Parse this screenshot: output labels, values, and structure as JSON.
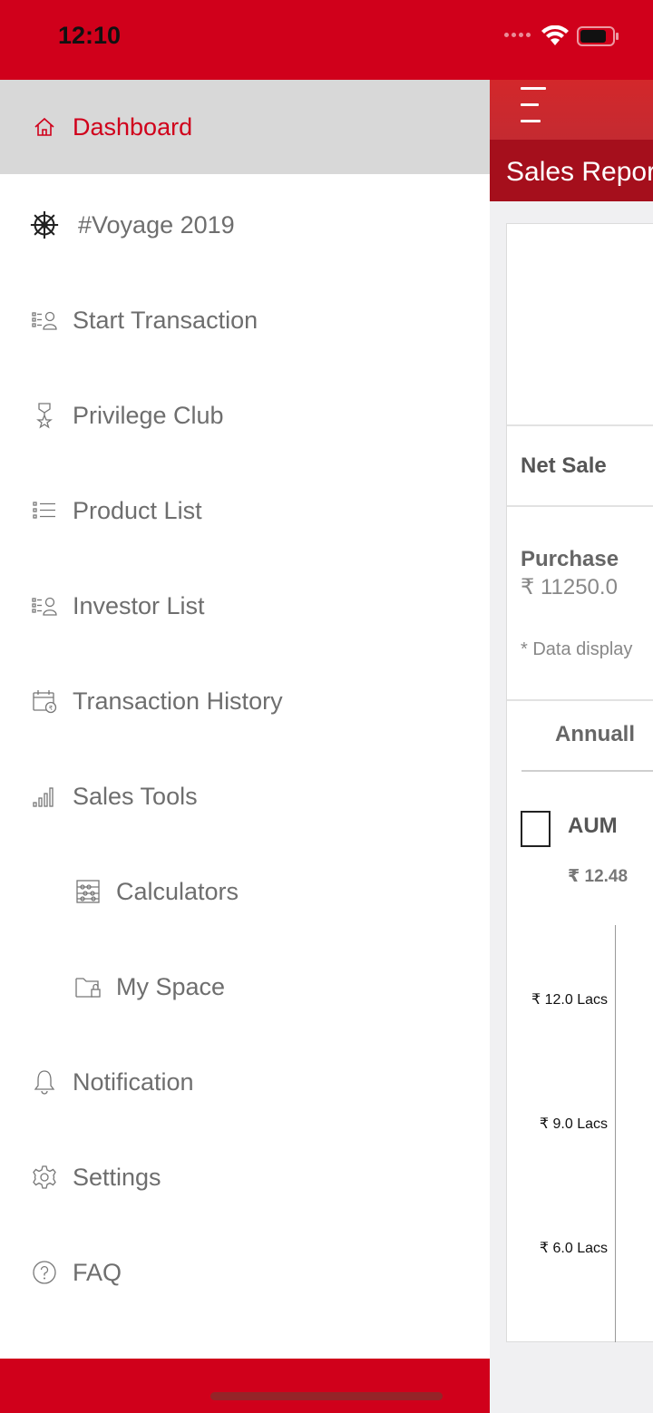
{
  "status_bar": {
    "time": "12:10"
  },
  "background_app": {
    "title": "Sales Repor",
    "net_sale_label": "Net Sale",
    "purchase_label": "Purchase",
    "purchase_value": "₹ 11250.0",
    "note": "* Data display",
    "tab_label": "Annuall",
    "legend_label": "AUM",
    "aum_value": "₹ 12.48",
    "y_ticks": [
      "₹ 12.0 Lacs",
      "₹ 9.0 Lacs",
      "₹ 6.0 Lacs"
    ]
  },
  "drawer": {
    "items": [
      {
        "label": "Dashboard",
        "icon": "home-icon",
        "active": true
      },
      {
        "label": "#Voyage 2019",
        "icon": "ship-wheel-icon"
      },
      {
        "label": "Start Transaction",
        "icon": "transaction-user-icon"
      },
      {
        "label": "Privilege Club",
        "icon": "award-icon"
      },
      {
        "label": "Product List",
        "icon": "list-icon"
      },
      {
        "label": "Investor List",
        "icon": "investor-list-icon"
      },
      {
        "label": "Transaction History",
        "icon": "calendar-rupee-icon"
      },
      {
        "label": "Sales Tools",
        "icon": "bar-chart-icon"
      },
      {
        "label": "Calculators",
        "icon": "abacus-icon",
        "sub": true
      },
      {
        "label": "My Space",
        "icon": "folder-lock-icon",
        "sub": true
      },
      {
        "label": "Notification",
        "icon": "bell-icon"
      },
      {
        "label": "Settings",
        "icon": "gear-icon"
      },
      {
        "label": "FAQ",
        "icon": "help-icon"
      }
    ]
  },
  "colors": {
    "brand_red": "#d0001b",
    "dark_red": "#a50f1c",
    "active_bg": "#d8d8d8",
    "text_gray": "#6e6e6e"
  }
}
